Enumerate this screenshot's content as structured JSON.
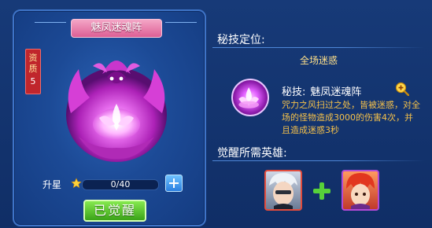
{
  "artifact": {
    "name": "魅凤迷魂阵",
    "quality_label": "资质",
    "quality_value": "5",
    "star_label": "升星",
    "star_progress_text": "0/40",
    "star_progress": 0,
    "awaken_label": "已觉醒"
  },
  "skill_section": {
    "positioning_title": "秘技定位:",
    "positioning_value": "全场迷惑",
    "skill_prefix": "秘技:",
    "skill_name": "魅凤迷魂阵",
    "skill_description": "咒力之风扫过之处，皆被迷惑，对全场的怪物造成3000的伤害4次，并且造成迷惑3秒"
  },
  "heroes_section": {
    "title": "觉醒所需英雄:",
    "heroes": [
      "hero-white-hair",
      "hero-red-hair"
    ]
  },
  "colors": {
    "background": "#173a78",
    "banner_pink": "#dd5f95",
    "awaken_green": "#3aa318",
    "desc_yellow": "#f5c14a",
    "positioning_yellow": "#ffe08a",
    "quality_red": "#c0262c"
  },
  "icons": [
    "star-icon",
    "plus-icon",
    "magnify-plus-icon",
    "green-plus-icon",
    "skill-lotus-icon"
  ]
}
